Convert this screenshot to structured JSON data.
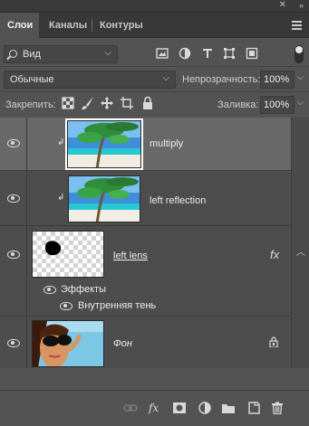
{
  "tabs": [
    {
      "label": "Слои",
      "active": true
    },
    {
      "label": "Каналы",
      "active": false
    },
    {
      "label": "Контуры",
      "active": false
    }
  ],
  "top_controls": {
    "collapse": "»",
    "close": "✕"
  },
  "filter": {
    "value": "Вид"
  },
  "blend": {
    "mode": "Обычные",
    "opacity_label": "Непрозрачность:",
    "opacity_value": "100%"
  },
  "lock": {
    "label": "Закрепить:",
    "fill_label": "Заливка:",
    "fill_value": "100%"
  },
  "layers": [
    {
      "name": "multiply",
      "selected": true,
      "clipped": true
    },
    {
      "name": "left reflection",
      "selected": false,
      "clipped": true
    },
    {
      "name": "left lens",
      "fx_badge": "fx"
    },
    {
      "effects_label": "Эффекты",
      "effect_item": "Внутренняя тень"
    },
    {
      "name": "Фон",
      "locked": true
    }
  ],
  "colors": {
    "panel": "#535353",
    "tabbar": "#383838",
    "selected_row": "#686868",
    "text": "#dcdcdc"
  }
}
